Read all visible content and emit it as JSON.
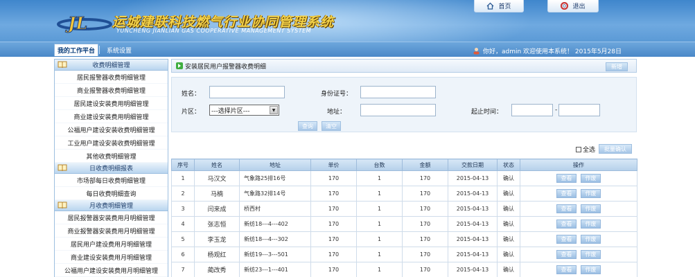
{
  "header": {
    "title": "运城建联科技燃气行业协同管理系统",
    "subtitle": "YUNCHENG JIANLIAN GAS COOPERATIVE MANAGEMENT SYSTEM",
    "home_label": "首页",
    "logout_label": "退出",
    "logo_icon": "jl-logo",
    "brand_color": "#4a88c8"
  },
  "nav": {
    "tabs": [
      "我的工作平台",
      "系统设置"
    ],
    "welcome": "你好，admin 欢迎使用本系统！ 2015年5月28日"
  },
  "sidebar": {
    "sections": [
      {
        "title": "收费明细管理",
        "items": [
          "居民报警器收费明细管理",
          "商业报警器收费明细管理",
          "居民建设安装费用明细管理",
          "商业建设安装费用明细管理",
          "公福用户建设安装收费明细管理",
          "工业用户建设安装收费明细管理",
          "其他收费明细管理"
        ]
      },
      {
        "title": "日收费明细报表",
        "items": [
          "市场部每日收费明细管理",
          "每日收费明细查询"
        ]
      },
      {
        "title": "月收费明细管理",
        "items": [
          "居民报警器安装费用月明细管理",
          "商业报警器安装费用月明细管理",
          "居民用户建设费用月明细管理",
          "商业建设安装费用月明细管理",
          "公福用户建设安装费用月明细管理"
        ]
      }
    ]
  },
  "main": {
    "breadcrumb": "安装居民用户报警器收费明细",
    "add_label": "新增",
    "search": {
      "name_label": "姓名：",
      "name_value": "",
      "id_label": "身份证号：",
      "id_value": "",
      "area_label": "片区：",
      "area_selected": "---选择片区---",
      "address_label": "地址：",
      "address_value": "",
      "date_label": "起止时间：",
      "date_from": "",
      "date_sep": "-",
      "date_to": "",
      "query_label": "查询",
      "clear_label": "清空"
    },
    "select_all_label": "全选",
    "batch_confirm_label": "批量确认",
    "table": {
      "columns": [
        "序号",
        "姓名",
        "地址",
        "单价",
        "台数",
        "金额",
        "交款日期",
        "状态",
        "操作"
      ],
      "view_label": "查看",
      "void_label": "作废",
      "rows": [
        {
          "no": "1",
          "name": "马汉文",
          "addr": "气象路25排16号",
          "price": "170",
          "count": "1",
          "amount": "170",
          "date": "2015-04-13",
          "status": "确认"
        },
        {
          "no": "2",
          "name": "马楠",
          "addr": "气象路32排14号",
          "price": "170",
          "count": "1",
          "amount": "170",
          "date": "2015-04-13",
          "status": "确认"
        },
        {
          "no": "3",
          "name": "闫来成",
          "addr": "桥西村",
          "price": "170",
          "count": "1",
          "amount": "170",
          "date": "2015-04-13",
          "status": "确认"
        },
        {
          "no": "4",
          "name": "张志恒",
          "addr": "新纺18---4---402",
          "price": "170",
          "count": "1",
          "amount": "170",
          "date": "2015-04-13",
          "status": "确认"
        },
        {
          "no": "5",
          "name": "李玉龙",
          "addr": "新纺18---4---302",
          "price": "170",
          "count": "1",
          "amount": "170",
          "date": "2015-04-13",
          "status": "确认"
        },
        {
          "no": "6",
          "name": "杨观红",
          "addr": "新纺19---3---501",
          "price": "170",
          "count": "1",
          "amount": "170",
          "date": "2015-04-13",
          "status": "确认"
        },
        {
          "no": "7",
          "name": "蔺改秀",
          "addr": "新纺23---1---401",
          "price": "170",
          "count": "1",
          "amount": "170",
          "date": "2015-04-13",
          "status": "确认"
        }
      ]
    }
  }
}
